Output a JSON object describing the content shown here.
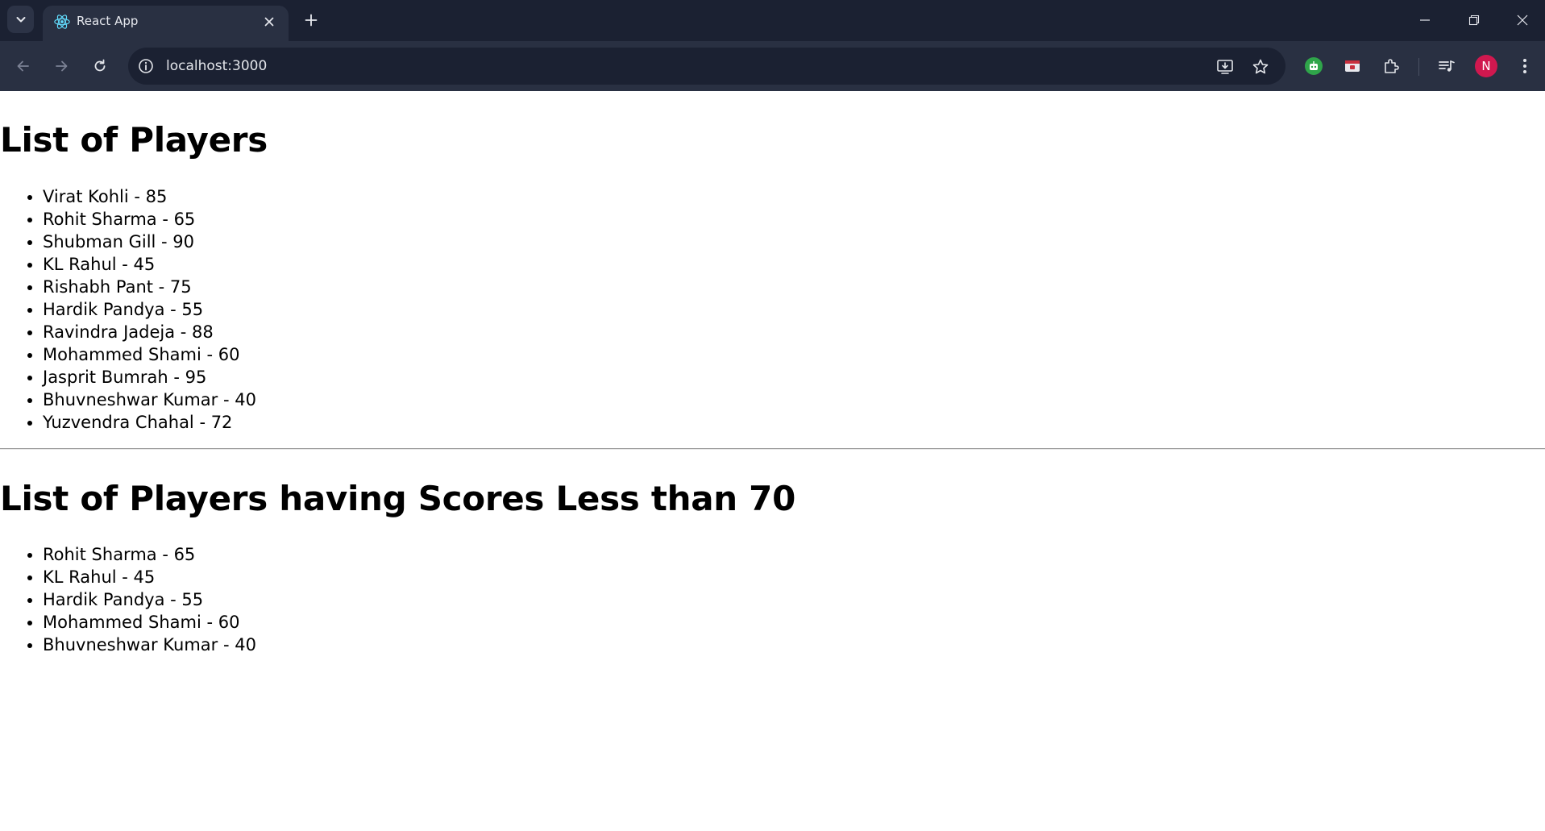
{
  "browser": {
    "tab_title": "React App",
    "url": "localhost:3000",
    "profile_initial": "N",
    "accent_color": "#d0184f",
    "icons": [
      "tab-search-icon",
      "react-favicon-icon",
      "close-icon",
      "plus-icon",
      "minimize-icon",
      "restore-icon",
      "window-close-icon",
      "back-icon",
      "forward-icon",
      "reload-icon",
      "info-icon",
      "install-app-icon",
      "star-icon",
      "extension-robot-icon",
      "extension-wallet-icon",
      "extensions-puzzle-icon",
      "media-control-icon",
      "menu-kebab-icon"
    ]
  },
  "page": {
    "heading_all": "List of Players",
    "players": [
      {
        "text": "Virat Kohli - 85"
      },
      {
        "text": "Rohit Sharma - 65"
      },
      {
        "text": "Shubman Gill - 90"
      },
      {
        "text": "KL Rahul - 45"
      },
      {
        "text": "Rishabh Pant - 75"
      },
      {
        "text": "Hardik Pandya - 55"
      },
      {
        "text": "Ravindra Jadeja - 88"
      },
      {
        "text": "Mohammed Shami - 60"
      },
      {
        "text": "Jasprit Bumrah - 95"
      },
      {
        "text": "Bhuvneshwar Kumar - 40"
      },
      {
        "text": "Yuzvendra Chahal - 72"
      }
    ],
    "heading_filtered": "List of Players having Scores Less than 70",
    "filtered_players": [
      {
        "text": "Rohit Sharma - 65"
      },
      {
        "text": "KL Rahul - 45"
      },
      {
        "text": "Hardik Pandya - 55"
      },
      {
        "text": "Mohammed Shami - 60"
      },
      {
        "text": "Bhuvneshwar Kumar - 40"
      }
    ]
  }
}
